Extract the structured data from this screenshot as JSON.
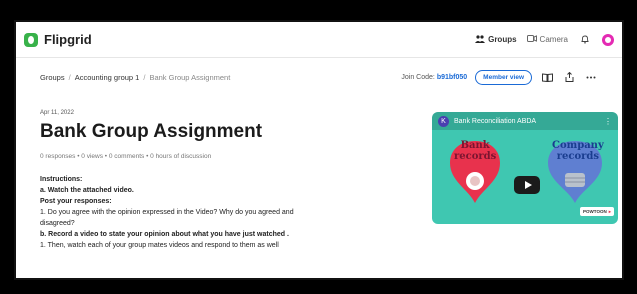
{
  "app": {
    "name": "Flipgrid"
  },
  "topbar": {
    "groups_label": "Groups",
    "camera_label": "Camera"
  },
  "breadcrumb": {
    "items": [
      "Groups",
      "Accounting group 1",
      "Bank Group Assignment"
    ],
    "separator": "/"
  },
  "join": {
    "label": "Join Code:",
    "code": "b91bf050"
  },
  "member_view_label": "Member view",
  "assignment": {
    "date": "Apr 11, 2022",
    "title": "Bank Group Assignment",
    "stats": "0 responses • 0 views • 0 comments • 0 hours of discussion"
  },
  "instructions": {
    "heading": "Instructions:",
    "line_a": "a. Watch the attached video.",
    "post_heading": "Post your responses:",
    "line_1": "1. Do you agree with the opinion expressed in the Video? Why do you agreed and",
    "line_1_cont": "disagreed?",
    "line_b": "b. Record a video to state your opinion about what you have just watched .",
    "line_1b": "1. Then, watch each of your group mates videos and respond to them as well"
  },
  "video": {
    "avatar_letter": "K",
    "title": "Bank Reconciliation ABDA",
    "bank_label_1": "Bank",
    "bank_label_2": "records",
    "company_label_1": "Company",
    "company_label_2": "records",
    "brand": "POWTOON"
  },
  "colors": {
    "accent": "#1a6ad6",
    "logo_green": "#38b24a",
    "video_bg": "#3fc7b1",
    "bank_red": "#e8324d",
    "company_blue": "#5f7fd1"
  }
}
